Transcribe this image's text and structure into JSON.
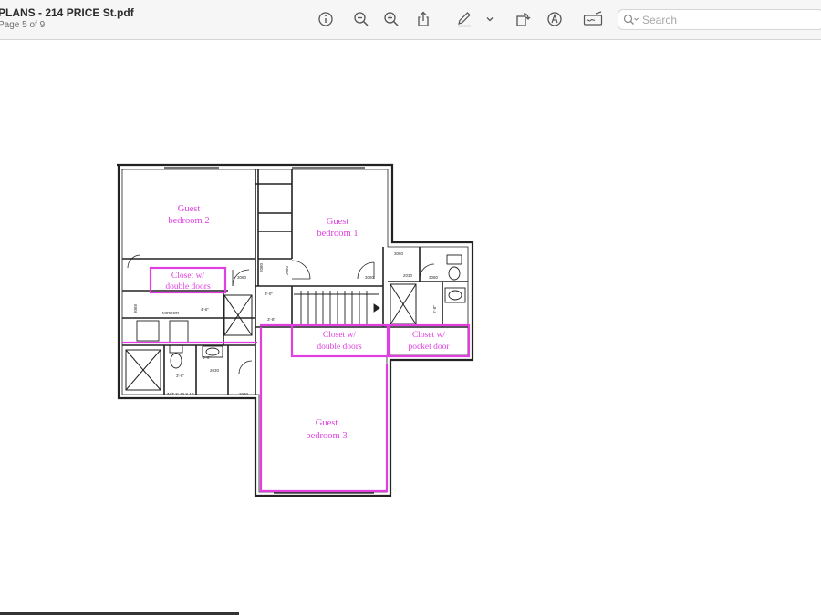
{
  "window": {
    "doc_title": "PLANS - 214 PRICE St.pdf",
    "page_indicator": "Page 5 of 9"
  },
  "toolbar": {
    "buttons": [
      {
        "name": "info-icon"
      },
      {
        "name": "zoom-out-icon"
      },
      {
        "name": "zoom-in-icon"
      },
      {
        "name": "share-icon"
      },
      {
        "name": "markup-pen-icon"
      },
      {
        "name": "chevron-down-icon"
      },
      {
        "name": "rotate-icon"
      },
      {
        "name": "annotate-circle-a-icon"
      },
      {
        "name": "signature-icon"
      }
    ],
    "search": {
      "placeholder": "Search",
      "value": ""
    }
  },
  "colors": {
    "highlight": "#e040e0",
    "toolbar_bg": "#f6f6f6",
    "linework": "#222222"
  },
  "floor_plan": {
    "rooms": {
      "guest_bedroom_2": [
        "Guest",
        "bedroom 2"
      ],
      "guest_bedroom_1": [
        "Guest",
        "bedroom 1"
      ],
      "guest_bedroom_3": [
        "Guest",
        "bedroom 3"
      ]
    },
    "closets": {
      "closet_a": [
        "Closet w/",
        "double doors"
      ],
      "closet_b": [
        "Closet w/",
        "double doors"
      ],
      "closet_c": [
        "Closet w/",
        "pocket door"
      ]
    },
    "dims": {
      "d1": "3080",
      "d2": "3080",
      "d3": "2080",
      "d4": "3068",
      "d5": "3080",
      "d6": "2080",
      "d7": "MIRROR",
      "d8": "3'-6\"",
      "d9": "4'-6\"",
      "d10": "3'-0\"",
      "d11": "3'-8\"",
      "d12": "3'-8\"",
      "d13": "2'-8\"",
      "d14": "LIN/T 3'-10 X 10",
      "d15": "2030",
      "d16": "2030",
      "d17": "3080",
      "d18": "2030"
    }
  }
}
